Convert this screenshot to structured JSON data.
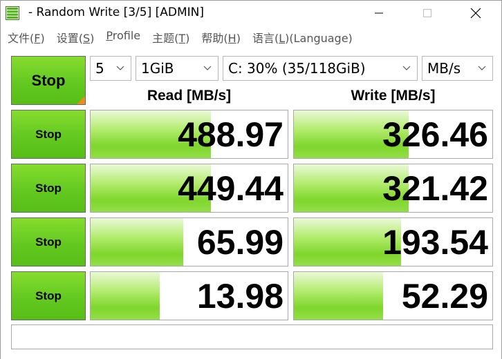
{
  "window": {
    "title": "- Random Write [3/5] [ADMIN]"
  },
  "menu": {
    "items": [
      {
        "label": "文件(",
        "mnemonic": "F",
        "suffix": ")"
      },
      {
        "label": "设置(",
        "mnemonic": "S",
        "suffix": ")"
      },
      {
        "label": "",
        "mnemonic": "P",
        "suffix": "rofile"
      },
      {
        "label": "主题(",
        "mnemonic": "T",
        "suffix": ")"
      },
      {
        "label": "帮助(",
        "mnemonic": "H",
        "suffix": ")"
      },
      {
        "label": "语言(",
        "mnemonic": "L",
        "suffix": ")(Language)"
      }
    ]
  },
  "controls": {
    "all_button": "Stop",
    "count": "5",
    "size": "1GiB",
    "drive": "C: 30% (35/118GiB)",
    "unit": "MB/s"
  },
  "headers": {
    "read": "Read [MB/s]",
    "write": "Write [MB/s]"
  },
  "rows": [
    {
      "button": "Stop",
      "read": "488.97",
      "write": "326.46",
      "read_fill": 0.61,
      "write_fill": 0.58
    },
    {
      "button": "Stop",
      "read": "449.44",
      "write": "321.42",
      "read_fill": 0.61,
      "write_fill": 0.58
    },
    {
      "button": "Stop",
      "read": "65.99",
      "write": "193.54",
      "read_fill": 0.47,
      "write_fill": 0.54
    },
    {
      "button": "Stop",
      "read": "13.98",
      "write": "52.29",
      "read_fill": 0.35,
      "write_fill": 0.45
    }
  ],
  "comment": "",
  "colors": {
    "button_green": "#63c920",
    "bar_green": "#7fd62c",
    "corner_orange": "#f08a1c"
  },
  "icons": {
    "app": "bar-chart-icon",
    "minimize": "minimize-icon",
    "maximize": "maximize-icon",
    "close": "close-icon",
    "dropdown": "chevron-down-icon"
  }
}
